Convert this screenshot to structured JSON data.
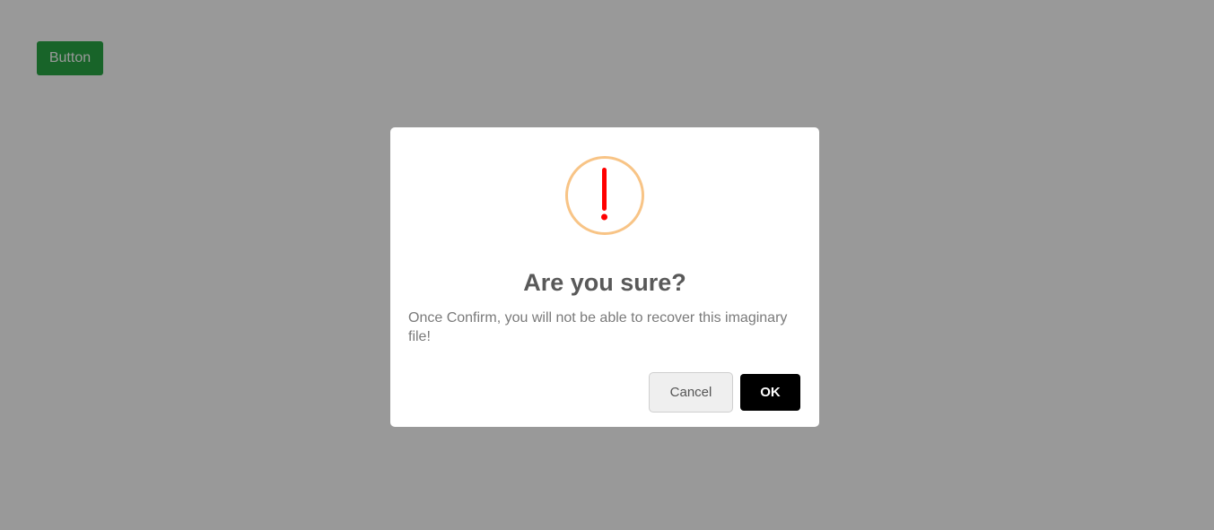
{
  "page": {
    "button_label": "Button",
    "button_color": "#28a745"
  },
  "dialog": {
    "icon": "warning-exclamation-icon",
    "icon_ring_color": "#f8c486",
    "icon_mark_color": "#ff0000",
    "title": "Are you sure?",
    "text": "Once Confirm, you will not be able to recover this imaginary file!",
    "cancel_label": "Cancel",
    "ok_label": "OK"
  }
}
